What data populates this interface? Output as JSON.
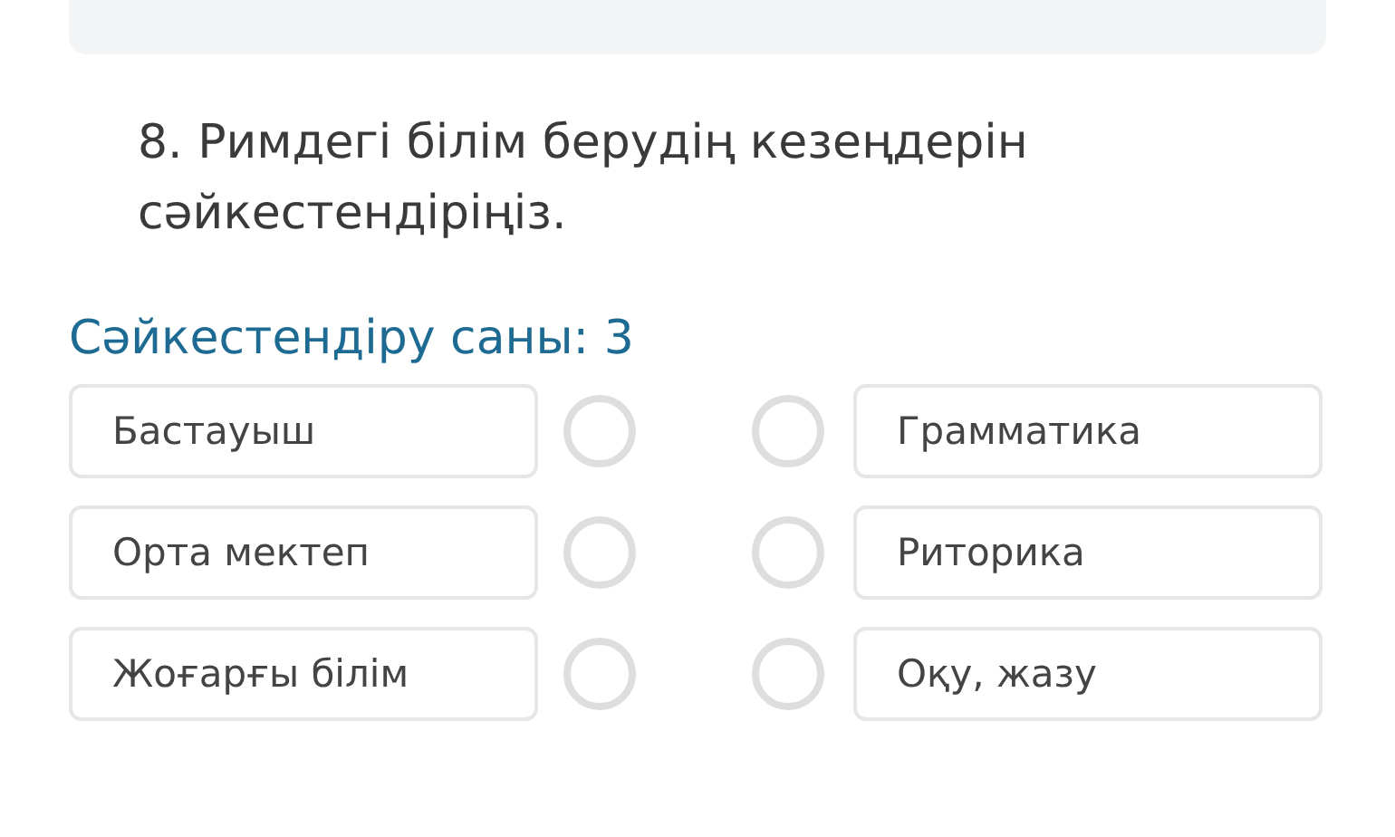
{
  "question": {
    "text": "8. Римдегі білім берудің кезеңдерін сәйкестендіріңіз."
  },
  "match_count": "Сәйкестендіру саны: 3",
  "pairs": [
    {
      "left": "Бастауыш",
      "right": "Грамматика"
    },
    {
      "left": "Орта мектеп",
      "right": "Риторика"
    },
    {
      "left": "Жоғарғы білім",
      "right": "Оқу, жазу"
    }
  ]
}
